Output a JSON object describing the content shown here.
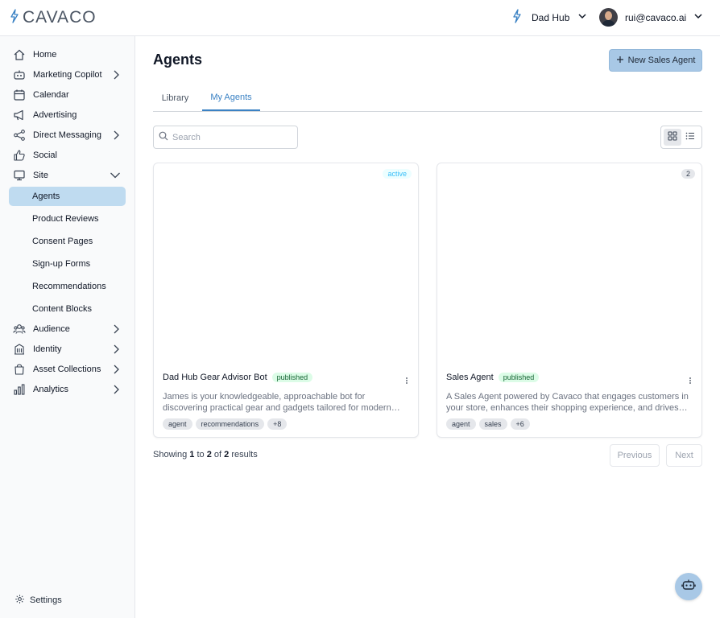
{
  "brand": {
    "name": "CAVACO"
  },
  "header": {
    "workspace": "Dad Hub",
    "user_email": "rui@cavaco.ai"
  },
  "sidebar": {
    "items": [
      {
        "label": "Home",
        "icon": "home-icon"
      },
      {
        "label": "Marketing Copilot",
        "icon": "robot-icon"
      },
      {
        "label": "Calendar",
        "icon": "calendar-icon"
      },
      {
        "label": "Advertising",
        "icon": "megaphone-icon"
      },
      {
        "label": "Direct Messaging",
        "icon": "share-icon"
      },
      {
        "label": "Social",
        "icon": "thumbs-up-icon"
      },
      {
        "label": "Site",
        "icon": "monitor-icon"
      },
      {
        "label": "Audience",
        "icon": "users-icon"
      },
      {
        "label": "Identity",
        "icon": "building-icon"
      },
      {
        "label": "Asset Collections",
        "icon": "bag-icon"
      },
      {
        "label": "Analytics",
        "icon": "chart-icon"
      }
    ],
    "site_children": [
      "Agents",
      "Product Reviews",
      "Consent Pages",
      "Sign-up Forms",
      "Recommendations",
      "Content Blocks"
    ],
    "active_child": "Agents",
    "settings_label": "Settings"
  },
  "main": {
    "title": "Agents",
    "new_button": "New Sales Agent",
    "tabs": [
      "Library",
      "My Agents"
    ],
    "active_tab": "My Agents",
    "search_placeholder": "Search",
    "cards": [
      {
        "title": "Dad Hub Gear Advisor Bot",
        "status": "published",
        "corner": "active",
        "description": "James is your knowledgeable, approachable bot for discovering practical gear and gadgets tailored for modern dads. Get...",
        "tags": [
          "agent",
          "recommendations",
          "+8"
        ]
      },
      {
        "title": "Sales Agent",
        "status": "published",
        "corner": "2",
        "description": "A Sales Agent powered by Cavaco that engages customers in your store, enhances their shopping experience, and drives sales with...",
        "tags": [
          "agent",
          "sales",
          "+6"
        ]
      }
    ],
    "results": {
      "prefix": "Showing",
      "from": "1",
      "to_word": "to",
      "to": "2",
      "of_word": "of",
      "total": "2",
      "suffix": "results"
    },
    "pagination": {
      "previous": "Previous",
      "next": "Next"
    }
  },
  "colors": {
    "accent": "#3b82c4",
    "button_bg": "#a8c8e6",
    "active_nav": "#bfdbf0"
  }
}
